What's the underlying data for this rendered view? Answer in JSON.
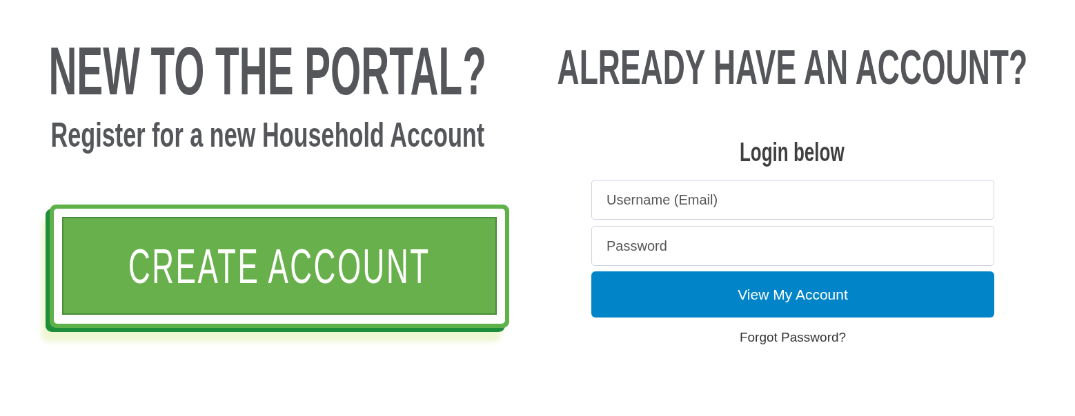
{
  "register": {
    "heading": "NEW TO THE PORTAL?",
    "subheading": "Register for a new Household Account",
    "button": "CREATE ACCOUNT"
  },
  "login": {
    "heading": "ALREADY HAVE AN ACCOUNT?",
    "prompt": "Login below",
    "fields": [
      {
        "placeholder": "Username (Email)"
      },
      {
        "placeholder": "Password"
      }
    ],
    "submit_button": "View My Account",
    "forgot_link": "Forgot Password?"
  }
}
